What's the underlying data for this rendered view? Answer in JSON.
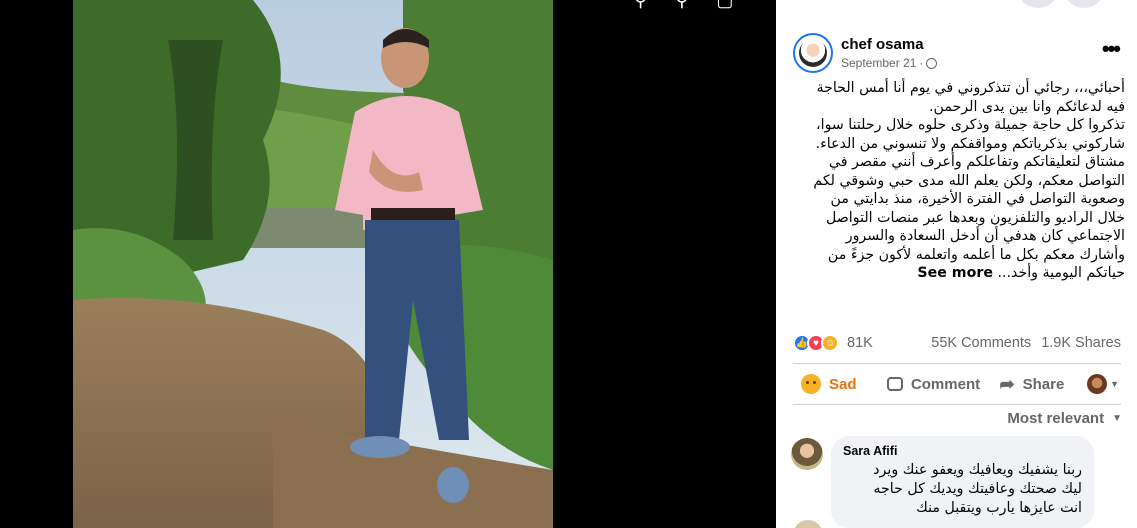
{
  "post": {
    "author": "chef osama",
    "date": "September 21",
    "date_sep": "·",
    "text_lines": [
      "أحبائي،،، رجائي أن تتذكروني في يوم أنا أمس الحاجة",
      "فيه لدعائكم وانا بين يدى الرحمن.",
      "تذكروا كل حاجة جميلة وذكرى حلوه خلال رحلتنا سوا،",
      "شاركوني بذكرياتكم ومواقفكم ولا تنسوني من الدعاء.",
      "مشتاق لتعليقاتكم وتفاعلكم وأعرف أنني مقصر في",
      "التواصل معكم، ولكن يعلم الله مدى حبي وشوقي لكم",
      "وصعوبة التواصل في الفترة الأخيرة، منذ بدايتي من",
      "خلال الراديو والتلفزيون وبعدها عبر منصات التواصل",
      "الاجتماعي كان هدفي أن أدخل السعادة والسرور",
      "وأشارك معكم بكل ما أعلمه واتعلمه لأكون جزءً من"
    ],
    "last_line": "حياتكم اليومية وأخد...",
    "see_more": "See more",
    "reactions_count": "81K",
    "comments_count": "55K Comments",
    "shares_count": "1.9K Shares"
  },
  "actions": {
    "sad": "Sad",
    "comment": "Comment",
    "share": "Share"
  },
  "sort_label": "Most relevant",
  "comments": [
    {
      "author": "Sara Afifi",
      "text_lines": [
        "ربنا يشفيك ويعافيك ويعفو عنك ويرد",
        "ليك صحتك وعافيتك ويديك كل حاجه",
        "انت عايزها يارب ويتقبل منك"
      ]
    }
  ],
  "colors": {
    "accent": "#1877f2",
    "sad": "#e9710f",
    "muted": "#65676b"
  }
}
